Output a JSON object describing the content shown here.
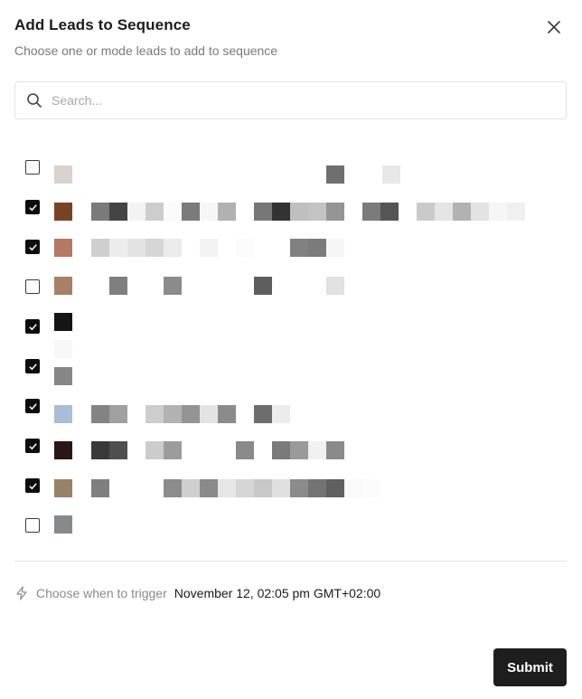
{
  "modal": {
    "title": "Add Leads to Sequence",
    "subtitle": "Choose one or mode leads to add to sequence"
  },
  "search": {
    "placeholder": "Search..."
  },
  "leads": [
    {
      "checked": false,
      "avatar_color": "#d9d2cd",
      "name_blocks": [
        [
          "#d9d2cd",
          0,
          0
        ]
      ],
      "redacted": true
    },
    {
      "checked": true,
      "avatar_color": "#7a4224",
      "redacted": true
    },
    {
      "checked": true,
      "avatar_color": "#b57860",
      "redacted": true
    },
    {
      "checked": false,
      "avatar_color": "#a78066",
      "redacted": true
    },
    {
      "checked": true,
      "avatar_color": "#151515",
      "redacted": true
    },
    {
      "checked": true,
      "avatar_color": "#868686",
      "redacted": true
    },
    {
      "checked": true,
      "avatar_color": "#a8bed6",
      "redacted": true
    },
    {
      "checked": true,
      "avatar_color": "#2a1614",
      "redacted": true
    },
    {
      "checked": true,
      "avatar_color": "#988069",
      "redacted": true
    },
    {
      "checked": false,
      "avatar_color": "#868a8a",
      "redacted": true
    }
  ],
  "trigger": {
    "label": "Choose when to trigger",
    "value": "November 12, 02:05 pm GMT+02:00"
  },
  "footer": {
    "submit_label": "Submit"
  },
  "colors": {
    "primary": "#1e1e1e",
    "muted_text": "#7a7a7a",
    "border": "#e3e3e3"
  }
}
